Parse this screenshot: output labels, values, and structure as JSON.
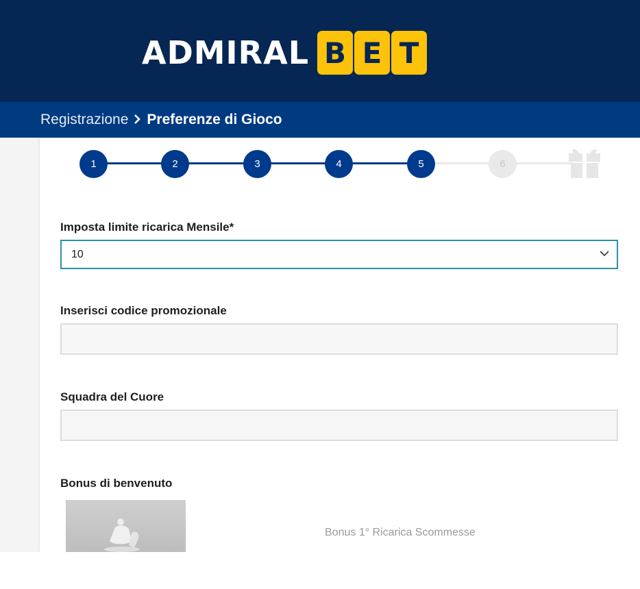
{
  "brand": {
    "logo_text": "ADMIRALBET",
    "admiral": "ADMIRAL",
    "bet_letters": [
      "B",
      "E",
      "T"
    ],
    "colors": {
      "header_bg": "#062653",
      "breadcrumb_bg": "#003a80",
      "logo_yellow": "#fdc30a",
      "step_active": "#003a8c"
    }
  },
  "breadcrumb": {
    "previous": "Registrazione",
    "separator_icon": "chevron-right-icon",
    "current": "Preferenze di Gioco"
  },
  "stepper": {
    "steps": [
      {
        "label": "1",
        "state": "active"
      },
      {
        "label": "2",
        "state": "active"
      },
      {
        "label": "3",
        "state": "active"
      },
      {
        "label": "4",
        "state": "active"
      },
      {
        "label": "5",
        "state": "active"
      },
      {
        "label": "6",
        "state": "inactive"
      }
    ],
    "final_icon": "gift-icon"
  },
  "form": {
    "monthly_limit": {
      "label": "Imposta limite ricarica Mensile*",
      "value": "10"
    },
    "promo_code": {
      "label": "Inserisci codice promozionale",
      "value": ""
    },
    "favorite_team": {
      "label": "Squadra del Cuore",
      "value": ""
    },
    "welcome_bonus": {
      "label": "Bonus di benvenuto",
      "option_text": "Bonus 1° Ricarica Scommesse"
    }
  }
}
